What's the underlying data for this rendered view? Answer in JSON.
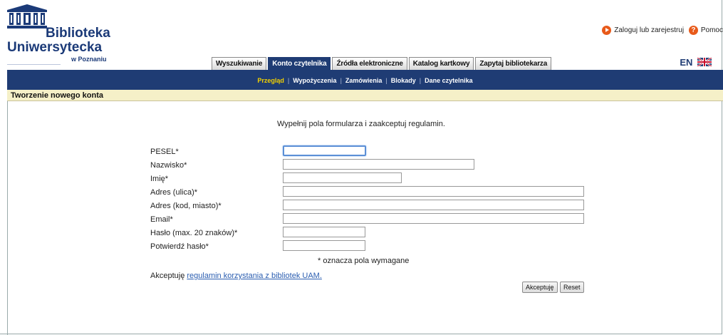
{
  "logo": {
    "line1": "Biblioteka",
    "line2": "Uniwersytecka",
    "line3": "w Poznaniu"
  },
  "top_links": {
    "login": "Zaloguj lub zarejestruj",
    "help": "Pomoc",
    "login_icon": "play-icon",
    "help_icon": "help-icon"
  },
  "tabs": [
    {
      "label": "Wyszukiwanie",
      "active": false
    },
    {
      "label": "Konto czytelnika",
      "active": true
    },
    {
      "label": "Źródła elektroniczne",
      "active": false
    },
    {
      "label": "Katalog kartkowy",
      "active": false
    },
    {
      "label": "Zapytaj bibliotekarza",
      "active": false
    }
  ],
  "language": {
    "code": "EN",
    "flag_icon": "uk-flag-icon"
  },
  "subnav": [
    {
      "label": "Przegląd",
      "active": true
    },
    {
      "label": "Wypożyczenia",
      "active": false
    },
    {
      "label": "Zamówienia",
      "active": false
    },
    {
      "label": "Blokady",
      "active": false
    },
    {
      "label": "Dane czytelnika",
      "active": false
    }
  ],
  "section_title": "Tworzenie nowego konta",
  "form": {
    "intro": "Wypełnij pola formularza i zaakceptuj regulamin.",
    "fields": [
      {
        "label": "PESEL*",
        "value": ""
      },
      {
        "label": "Nazwisko*",
        "value": ""
      },
      {
        "label": "Imię*",
        "value": ""
      },
      {
        "label": "Adres (ulica)*",
        "value": ""
      },
      {
        "label": "Adres (kod, miasto)*",
        "value": ""
      },
      {
        "label": "Email*",
        "value": ""
      },
      {
        "label": "Hasło (max. 20 znaków)*",
        "value": ""
      },
      {
        "label": "Potwierdź hasło*",
        "value": ""
      }
    ],
    "required_note": "* oznacza pola wymagane",
    "accept_prefix": "Akceptuję",
    "accept_link": "regulamin korzystania z bibliotek UAM.",
    "accept_button": "Akceptuję",
    "reset_button": "Reset"
  },
  "colors": {
    "navy": "#1f3c74",
    "active_subnav": "#f2d000",
    "section_bg": "#f5f0c8",
    "accent_orange": "#e85a1a"
  }
}
